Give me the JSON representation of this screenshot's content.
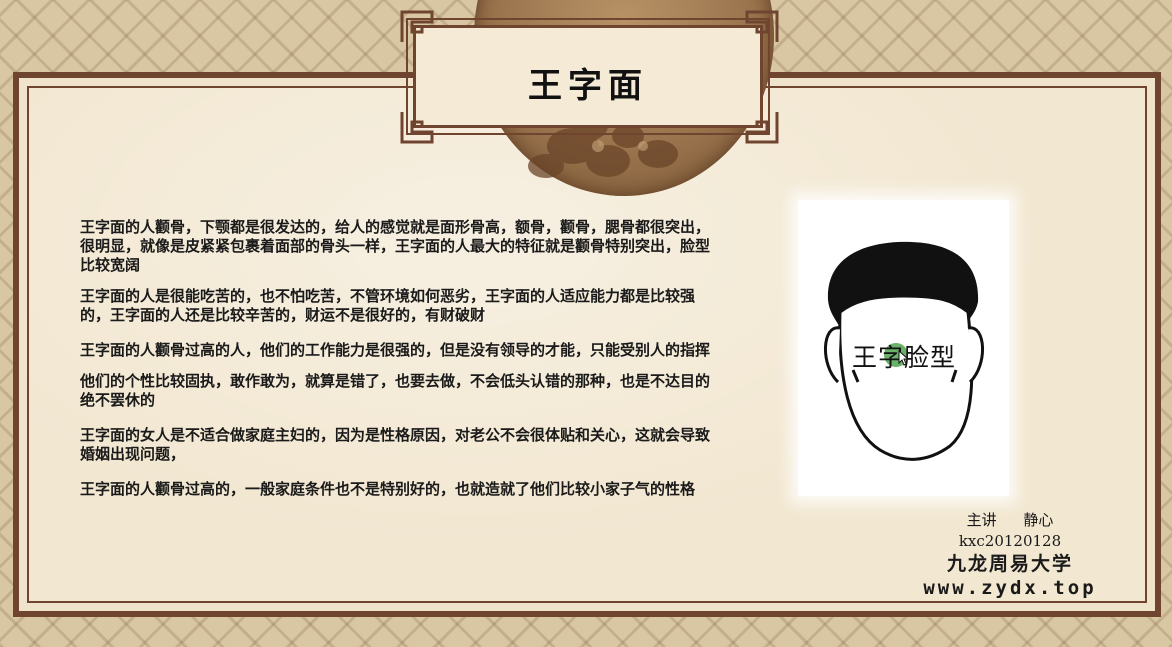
{
  "slide": {
    "title": "王字面",
    "paragraphs": [
      "王字面的人颧骨，下颚都是很发达的，给人的感觉就是面形骨高，额骨，颧骨，腮骨都很突出，很明显，就像是皮紧紧包裹着面部的骨头一样，王字面的人最大的特征就是颧骨特别突出，脸型比较宽阔",
      "王字面的人是很能吃苦的，也不怕吃苦，不管环境如何恶劣，王字面的人适应能力都是比较强的，王字面的人还是比较辛苦的，财运不是很好的，有财破财",
      "王字面的人颧骨过高的人，他们的工作能力是很强的，但是没有领导的才能，只能受别人的指挥",
      "他们的个性比较固执，敢作敢为，就算是错了，也要去做，不会低头认错的那种，也是不达目的绝不罢休的",
      "王字面的女人是不适合做家庭主妇的，因为是性格原因，对老公不会很体贴和关心，这就会导致婚姻出现问题，",
      "王字面的人颧骨过高的，一般家庭条件也不是特别好的，也就造就了他们比较小家子气的性格"
    ],
    "figure": {
      "label": "王字脸型",
      "icon": "face-outline-illustration",
      "highlight_color": "#5aa85a"
    },
    "credits": {
      "speaker_label": "主讲",
      "speaker_name": "静心",
      "id": "kxc20120128",
      "org": "九龙周易大学",
      "website": "www.zydx.top"
    }
  },
  "colors": {
    "frame": "#6f4530",
    "paper": "#f2e7d1",
    "background": "#d9c7a4"
  }
}
